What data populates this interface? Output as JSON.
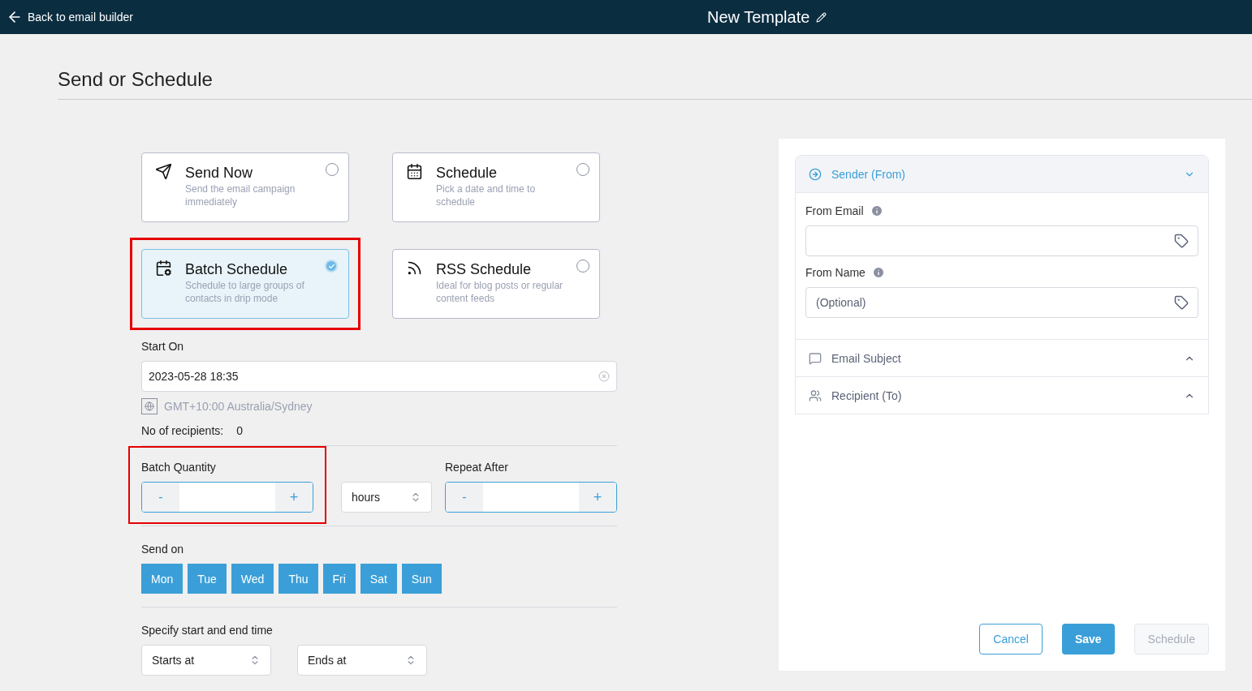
{
  "header": {
    "back_link": "Back to email builder",
    "title": "New Template"
  },
  "page_title": "Send or Schedule",
  "options": [
    {
      "kind": "send",
      "title": "Send Now",
      "description": "Send the email campaign immediately",
      "selected": false,
      "highlighted": false
    },
    {
      "kind": "calendar",
      "title": "Schedule",
      "description": "Pick a date and time to schedule",
      "selected": false,
      "highlighted": false
    },
    {
      "kind": "batch",
      "title": "Batch Schedule",
      "description": "Schedule to large groups of contacts in drip mode",
      "selected": true,
      "highlighted": true
    },
    {
      "kind": "rss",
      "title": "RSS Schedule",
      "description": "Ideal for blog posts or regular content feeds",
      "selected": false,
      "highlighted": false
    }
  ],
  "start_on": {
    "label": "Start On",
    "value": "2023-05-28 18:35",
    "timezone": "GMT+10:00 Australia/Sydney"
  },
  "recipients": {
    "label": "No of recipients:",
    "value": "0"
  },
  "batch_quantity": {
    "label": "Batch Quantity",
    "minus": "-",
    "plus": "+",
    "highlighted": true
  },
  "unit_select": {
    "value": "hours"
  },
  "repeat_after": {
    "label": "Repeat After",
    "minus": "-",
    "plus": "+"
  },
  "send_on": {
    "label": "Send on",
    "days": [
      {
        "label": "Mon",
        "selected": true
      },
      {
        "label": "Tue",
        "selected": true
      },
      {
        "label": "Wed",
        "selected": true
      },
      {
        "label": "Thu",
        "selected": true
      },
      {
        "label": "Fri",
        "selected": true
      },
      {
        "label": "Sat",
        "selected": true
      },
      {
        "label": "Sun",
        "selected": true
      }
    ]
  },
  "time_range": {
    "label": "Specify start and end time",
    "selects": [
      "Starts at",
      "Ends at"
    ]
  },
  "sections": [
    {
      "kind": "sender",
      "title": "Sender (From)",
      "expanded": true,
      "fields": [
        {
          "label": "From Email"
        },
        {
          "label": "From Name",
          "placeholder": "(Optional)"
        }
      ]
    },
    {
      "kind": "subject",
      "title": "Email Subject",
      "expanded": false
    },
    {
      "kind": "recipient",
      "title": "Recipient (To)",
      "expanded": false
    }
  ],
  "actions": [
    {
      "label": "Cancel",
      "kind": "outline"
    },
    {
      "label": "Save",
      "kind": "primary"
    },
    {
      "label": "Schedule",
      "kind": "disabled"
    }
  ]
}
